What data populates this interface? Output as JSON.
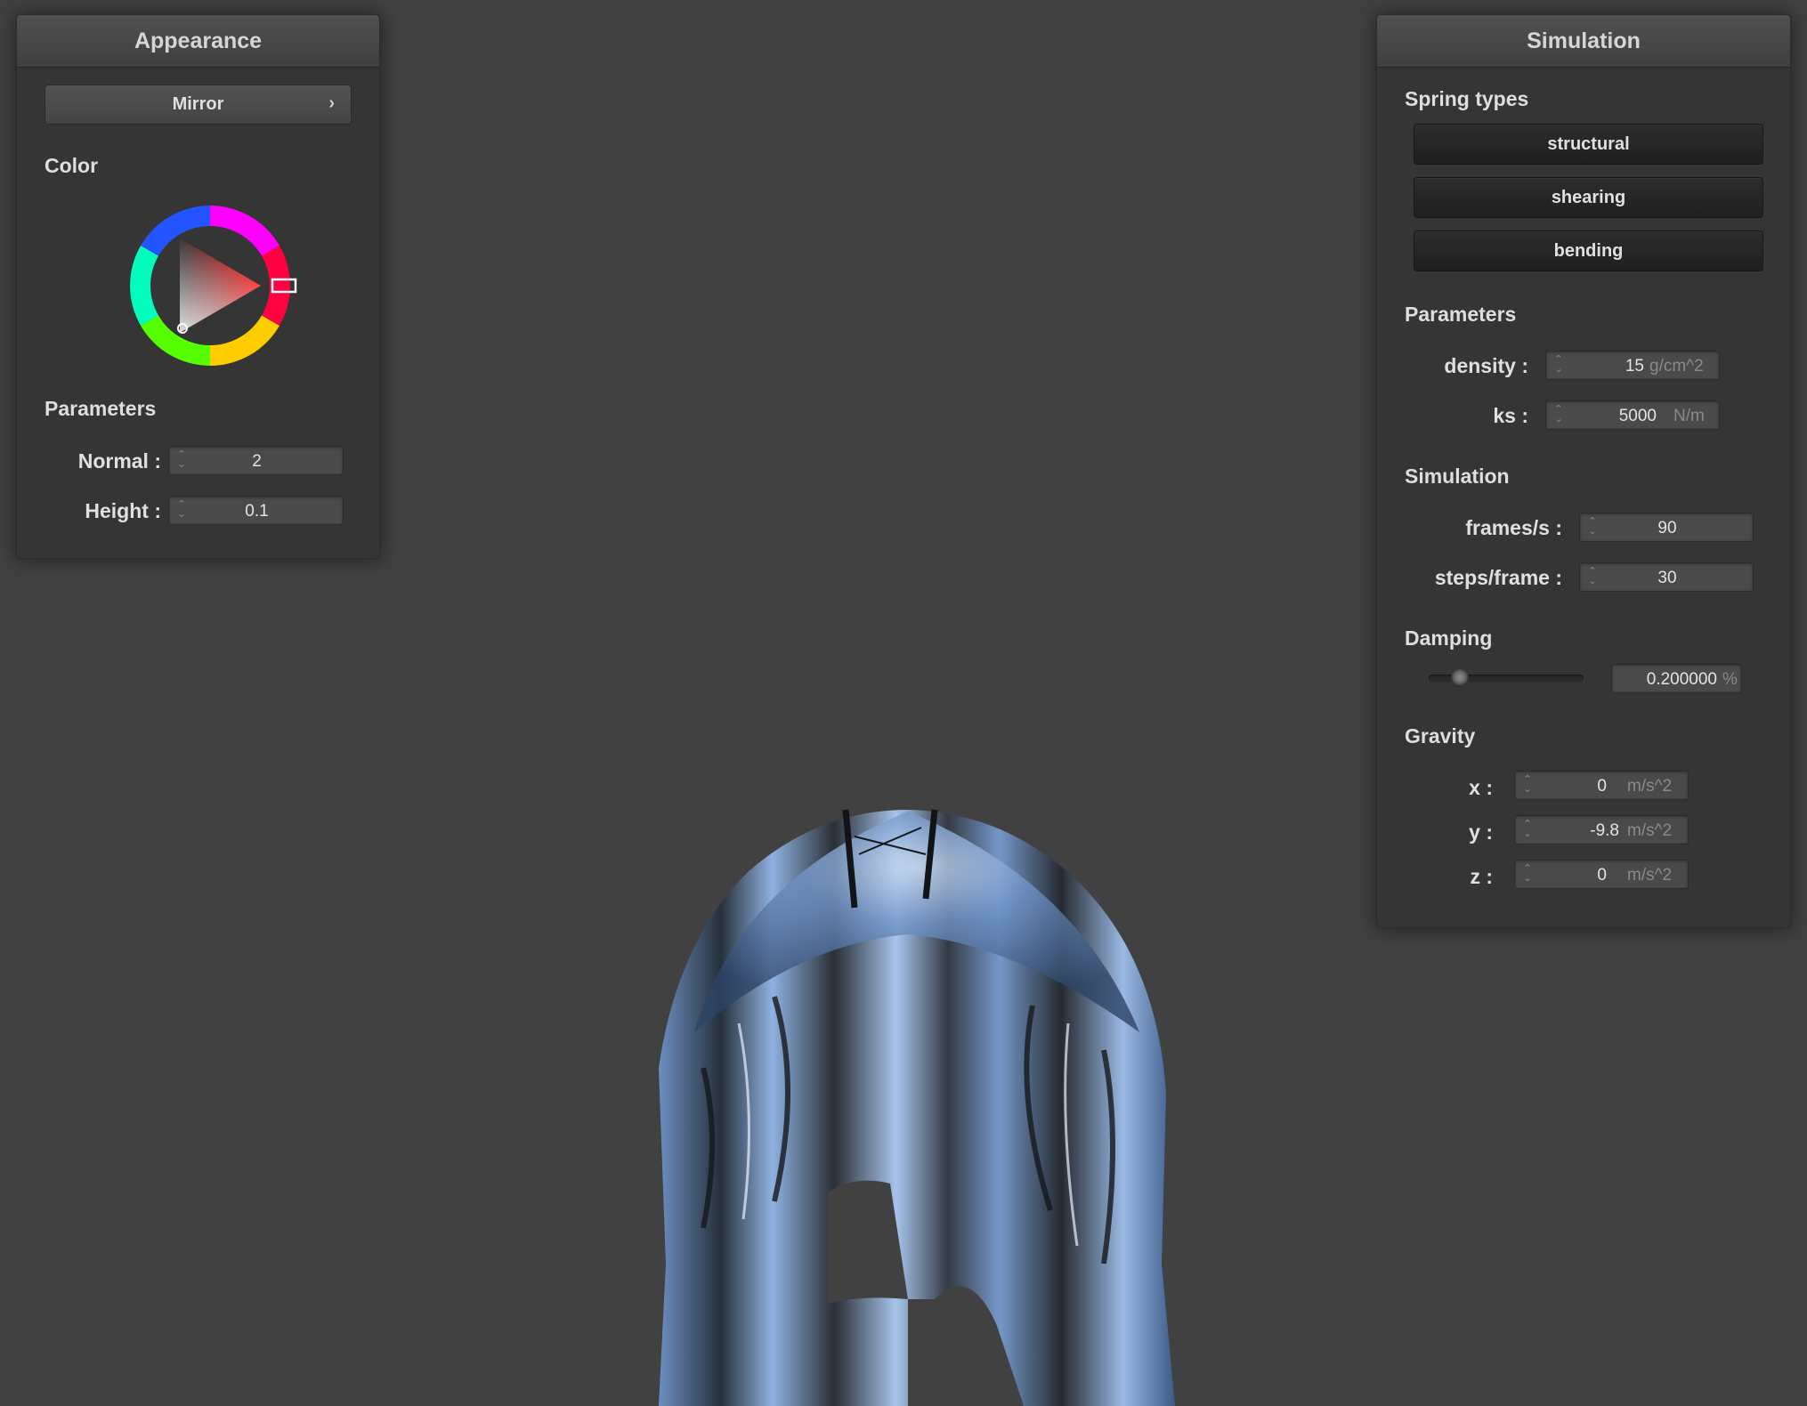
{
  "appearance": {
    "title": "Appearance",
    "shader_label": "Mirror",
    "popup_arrow": "›",
    "color_section": "Color",
    "params_section": "Parameters",
    "color_hue": "#ff0000",
    "params": [
      {
        "label": "Normal :",
        "value": "2"
      },
      {
        "label": "Height :",
        "value": "0.1"
      }
    ]
  },
  "simulation": {
    "title": "Simulation",
    "spring_section": "Spring types",
    "springs": [
      "structural",
      "shearing",
      "bending"
    ],
    "params_section": "Parameters",
    "density": {
      "label": "density :",
      "value": "15",
      "unit": "g/cm^2"
    },
    "ks": {
      "label": "ks :",
      "value": "5000",
      "unit": "N/m"
    },
    "sim_section": "Simulation",
    "fps": {
      "label": "frames/s :",
      "value": "90"
    },
    "steps": {
      "label": "steps/frame :",
      "value": "30"
    },
    "damping_section": "Damping",
    "damping": {
      "value": "0.200000",
      "unit": "%",
      "fraction": 0.2
    },
    "gravity_section": "Gravity",
    "gravity": [
      {
        "label": "x :",
        "value": "0",
        "unit": "m/s^2"
      },
      {
        "label": "y :",
        "value": "-9.8",
        "unit": "m/s^2"
      },
      {
        "label": "z :",
        "value": "0",
        "unit": "m/s^2"
      }
    ]
  },
  "spinner_icon": {
    "up": "⌃",
    "down": "⌄"
  }
}
